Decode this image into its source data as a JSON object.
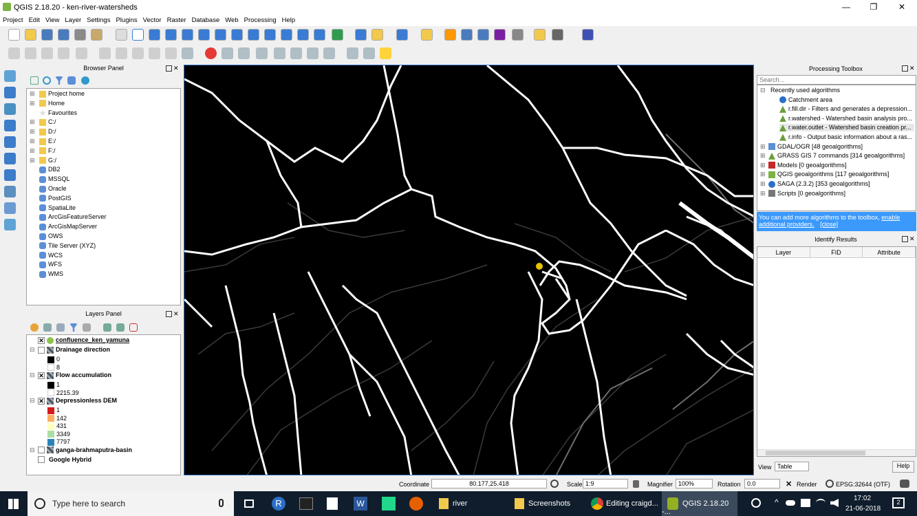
{
  "window": {
    "title": "QGIS 2.18.20 - ken-river-watersheds",
    "minimize": "—",
    "maximize": "❐",
    "close": "✕"
  },
  "menu": [
    "Project",
    "Edit",
    "View",
    "Layer",
    "Settings",
    "Plugins",
    "Vector",
    "Raster",
    "Database",
    "Web",
    "Processing",
    "Help"
  ],
  "browser": {
    "title": "Browser Panel",
    "items": [
      "Project home",
      "Home",
      "Favourites",
      "C:/",
      "D:/",
      "E:/",
      "F:/",
      "G:/",
      "DB2",
      "MSSQL",
      "Oracle",
      "PostGIS",
      "SpatiaLite",
      "ArcGisFeatureServer",
      "ArcGisMapServer",
      "OWS",
      "Tile Server (XYZ)",
      "WCS",
      "WFS",
      "WMS"
    ]
  },
  "layers": {
    "title": "Layers Panel",
    "items": [
      {
        "label": "confluence_ken_yamuna",
        "checked": true,
        "bold": true,
        "underline": true
      },
      {
        "label": "Drainage direction",
        "checked": false,
        "bold": true
      },
      {
        "label": "0",
        "legend": true,
        "color": "#000000"
      },
      {
        "label": "8",
        "legend": true,
        "color": "#ffffff"
      },
      {
        "label": "Flow accumulation",
        "checked": true,
        "bold": true
      },
      {
        "label": "1",
        "legend": true,
        "color": "#000000"
      },
      {
        "label": "2215.39",
        "legend": true,
        "color": "#ffffff"
      },
      {
        "label": "Depressionless DEM",
        "checked": true,
        "bold": true
      },
      {
        "label": "1",
        "legend": true,
        "color": "#d7191c"
      },
      {
        "label": "142",
        "legend": true,
        "color": "#fdae61"
      },
      {
        "label": "431",
        "legend": true,
        "color": "#ffffbf"
      },
      {
        "label": "3349",
        "legend": true,
        "color": "#abdda4"
      },
      {
        "label": "7797",
        "legend": true,
        "color": "#2b83ba"
      },
      {
        "label": "ganga-brahmaputra-basin",
        "checked": false,
        "bold": true
      },
      {
        "label": "Google Hybrid",
        "checked": false,
        "bold": true
      }
    ]
  },
  "toolbox": {
    "title": "Processing Toolbox",
    "search_placeholder": "Search...",
    "items": [
      "Recently used algorithms",
      "Catchment area",
      "r.fill.dir - Filters and generates a depression...",
      "r.watershed - Watershed basin analysis pro...",
      "r.water.outlet - Watershed basin creation pr...",
      "r.info - Output basic information about a ras...",
      "GDAL/OGR [48 geoalgorithms]",
      "GRASS GIS 7 commands [314 geoalgorithms]",
      "Models [0 geoalgorithms]",
      "QGIS geoalgorithms [117 geoalgorithms]",
      "SAGA (2.3.2) [353 geoalgorithms]",
      "Scripts [0 geoalgorithms]"
    ],
    "info_text": "You can add more algorithms to the toolbox,",
    "info_link": "enable additional providers.",
    "info_close": "[close]"
  },
  "identify": {
    "title": "Identify Results",
    "columns": [
      "Layer",
      "FID",
      "Attribute"
    ],
    "view_label": "View",
    "view_value": "Table",
    "help": "Help"
  },
  "status": {
    "coordinate_label": "Coordinate",
    "coordinate": "80.177,25.418",
    "scale_label": "Scale",
    "scale": "1:9",
    "magnifier_label": "Magnifier",
    "magnifier": "100%",
    "rotation_label": "Rotation",
    "rotation": "0.0",
    "render_label": "Render",
    "epsg": "EPSG:32644 (OTF)"
  },
  "taskbar": {
    "search": "Type here to search",
    "apps": [
      "river",
      "Screenshots",
      "Editing craigd...",
      "QGIS 2.18.20 -..."
    ],
    "time": "17:02",
    "date": "21-06-2018",
    "notif": "2"
  }
}
